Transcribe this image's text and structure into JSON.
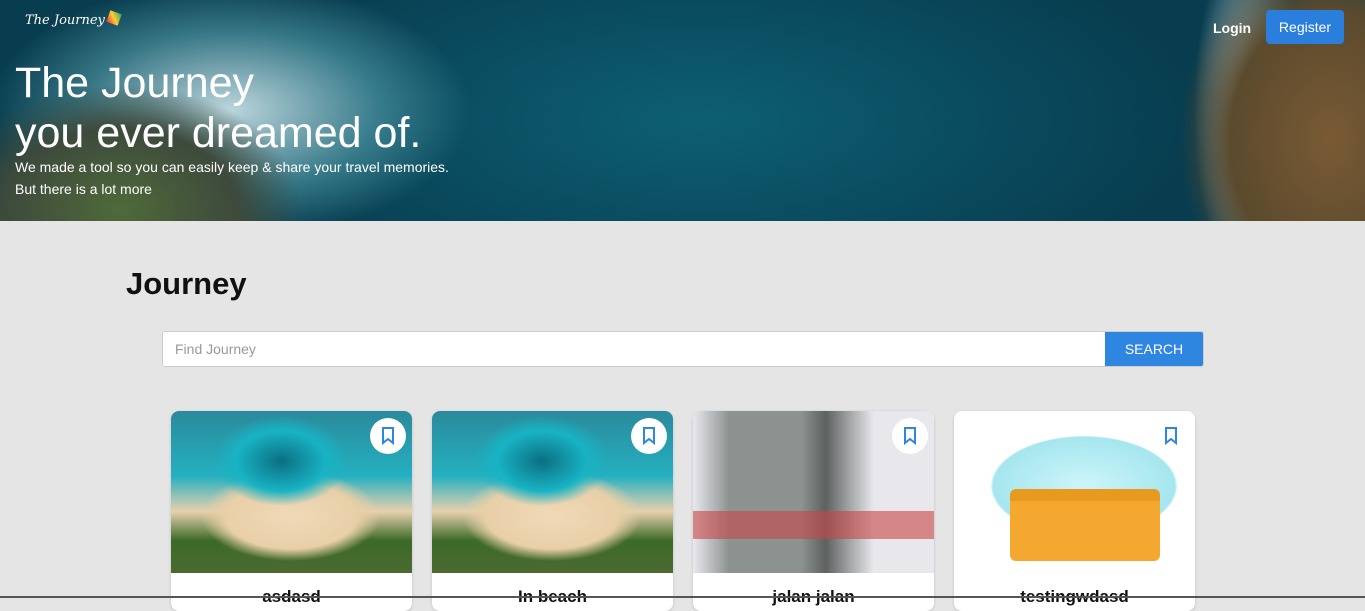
{
  "header": {
    "logo_text": "The Journey",
    "login": "Login",
    "register": "Register"
  },
  "hero": {
    "line1": "The Journey",
    "line2": "you ever dreamed of.",
    "sub1": "We made a tool so you can easily keep & share your travel memories.",
    "sub2": "But there is a lot more"
  },
  "main": {
    "title": "Journey",
    "search_placeholder": "Find Journey",
    "search_button": "SEARCH"
  },
  "cards": [
    {
      "title": "asdasd"
    },
    {
      "title": "In beach"
    },
    {
      "title": "jalan jalan"
    },
    {
      "title": "testingwdasd"
    }
  ],
  "colors": {
    "accent": "#2e86e0",
    "background": "#e5e5e5"
  }
}
